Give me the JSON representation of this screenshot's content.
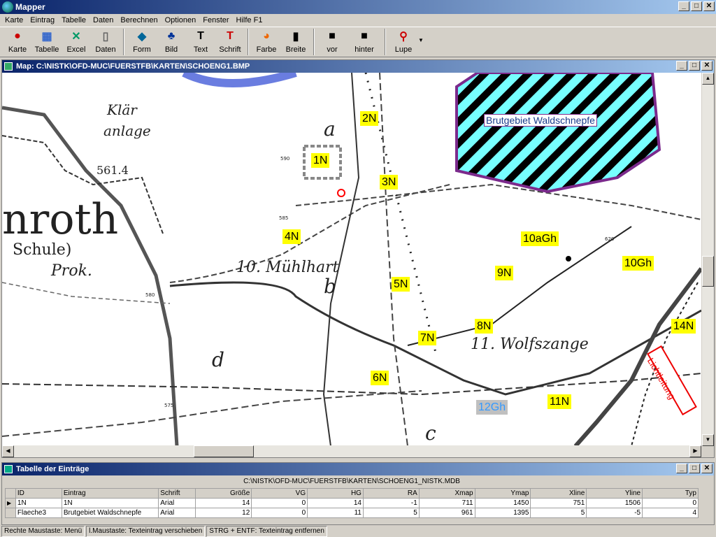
{
  "app": {
    "title": "Mapper"
  },
  "menu": [
    "Karte",
    "Eintrag",
    "Tabelle",
    "Daten",
    "Berechnen",
    "Optionen",
    "Fenster",
    "Hilfe F1"
  ],
  "toolbar": [
    {
      "label": "Karte",
      "icon": "karte-icon",
      "glyph": "●"
    },
    {
      "label": "Tabelle",
      "icon": "tabelle-icon",
      "glyph": "▦"
    },
    {
      "label": "Excel",
      "icon": "excel-icon",
      "glyph": "✕"
    },
    {
      "label": "Daten",
      "icon": "daten-icon",
      "glyph": "▯"
    },
    {
      "label": "Form",
      "icon": "form-icon",
      "glyph": "◆"
    },
    {
      "label": "Bild",
      "icon": "bild-icon",
      "glyph": "♣"
    },
    {
      "label": "Text",
      "icon": "text-icon",
      "glyph": "T"
    },
    {
      "label": "Schrift",
      "icon": "schrift-icon",
      "glyph": "T"
    },
    {
      "label": "Farbe",
      "icon": "farbe-icon",
      "glyph": "◕"
    },
    {
      "label": "Breite",
      "icon": "breite-icon",
      "glyph": "▮"
    },
    {
      "label": "vor",
      "icon": "vor-icon",
      "glyph": "■"
    },
    {
      "label": "hinter",
      "icon": "hinter-icon",
      "glyph": "■"
    },
    {
      "label": "Lupe",
      "icon": "lupe-icon",
      "glyph": "⚲"
    }
  ],
  "map": {
    "title": "Map: C:\\NISTK\\OFD-MUC\\FUERSTFB\\KARTEN\\SCHOENG1.BMP",
    "labels": [
      {
        "text": "1N"
      },
      {
        "text": "2N"
      },
      {
        "text": "3N"
      },
      {
        "text": "4N"
      },
      {
        "text": "5N"
      },
      {
        "text": "6N"
      },
      {
        "text": "7N"
      },
      {
        "text": "8N"
      },
      {
        "text": "9N"
      },
      {
        "text": "10aGh"
      },
      {
        "text": "10Gh"
      },
      {
        "text": "11N"
      },
      {
        "text": "12Gh"
      },
      {
        "text": "14N"
      }
    ],
    "area_label": "Brutgebiet Waldschnepfe",
    "line_label": "Lichtleitung",
    "map_text": [
      "Klär",
      "anlage",
      "a",
      "b",
      "c",
      "d",
      "nroth",
      "Schule)",
      "Prok.",
      "10. Mühlhart",
      "11. Wolfszange",
      "561.4",
      "585",
      "580",
      "590",
      "575",
      "620"
    ]
  },
  "table": {
    "title": "Tabelle der Einträge",
    "db_path": "C:\\NISTK\\OFD-MUC\\FUERSTFB\\KARTEN\\SCHOENG1_NISTK.MDB",
    "columns": [
      "ID",
      "Eintrag",
      "Schrift",
      "Größe",
      "VG",
      "HG",
      "RA",
      "Xmap",
      "Ymap",
      "Xline",
      "Yline",
      "Typ"
    ],
    "rows": [
      [
        "1N",
        "1N",
        "Arial",
        "14",
        "0",
        "14",
        "-1",
        "711",
        "1450",
        "751",
        "1506",
        "0"
      ],
      [
        "Flaeche3",
        "Brutgebiet Waldschnepfe",
        "Arial",
        "12",
        "0",
        "11",
        "5",
        "961",
        "1395",
        "5",
        "-5",
        "4"
      ]
    ]
  },
  "status": [
    "Rechte Maustaste: Menü",
    "l.Maustaste: Texteintrag verschieben",
    "STRG + ENTF: Texteintrag entfernen"
  ]
}
